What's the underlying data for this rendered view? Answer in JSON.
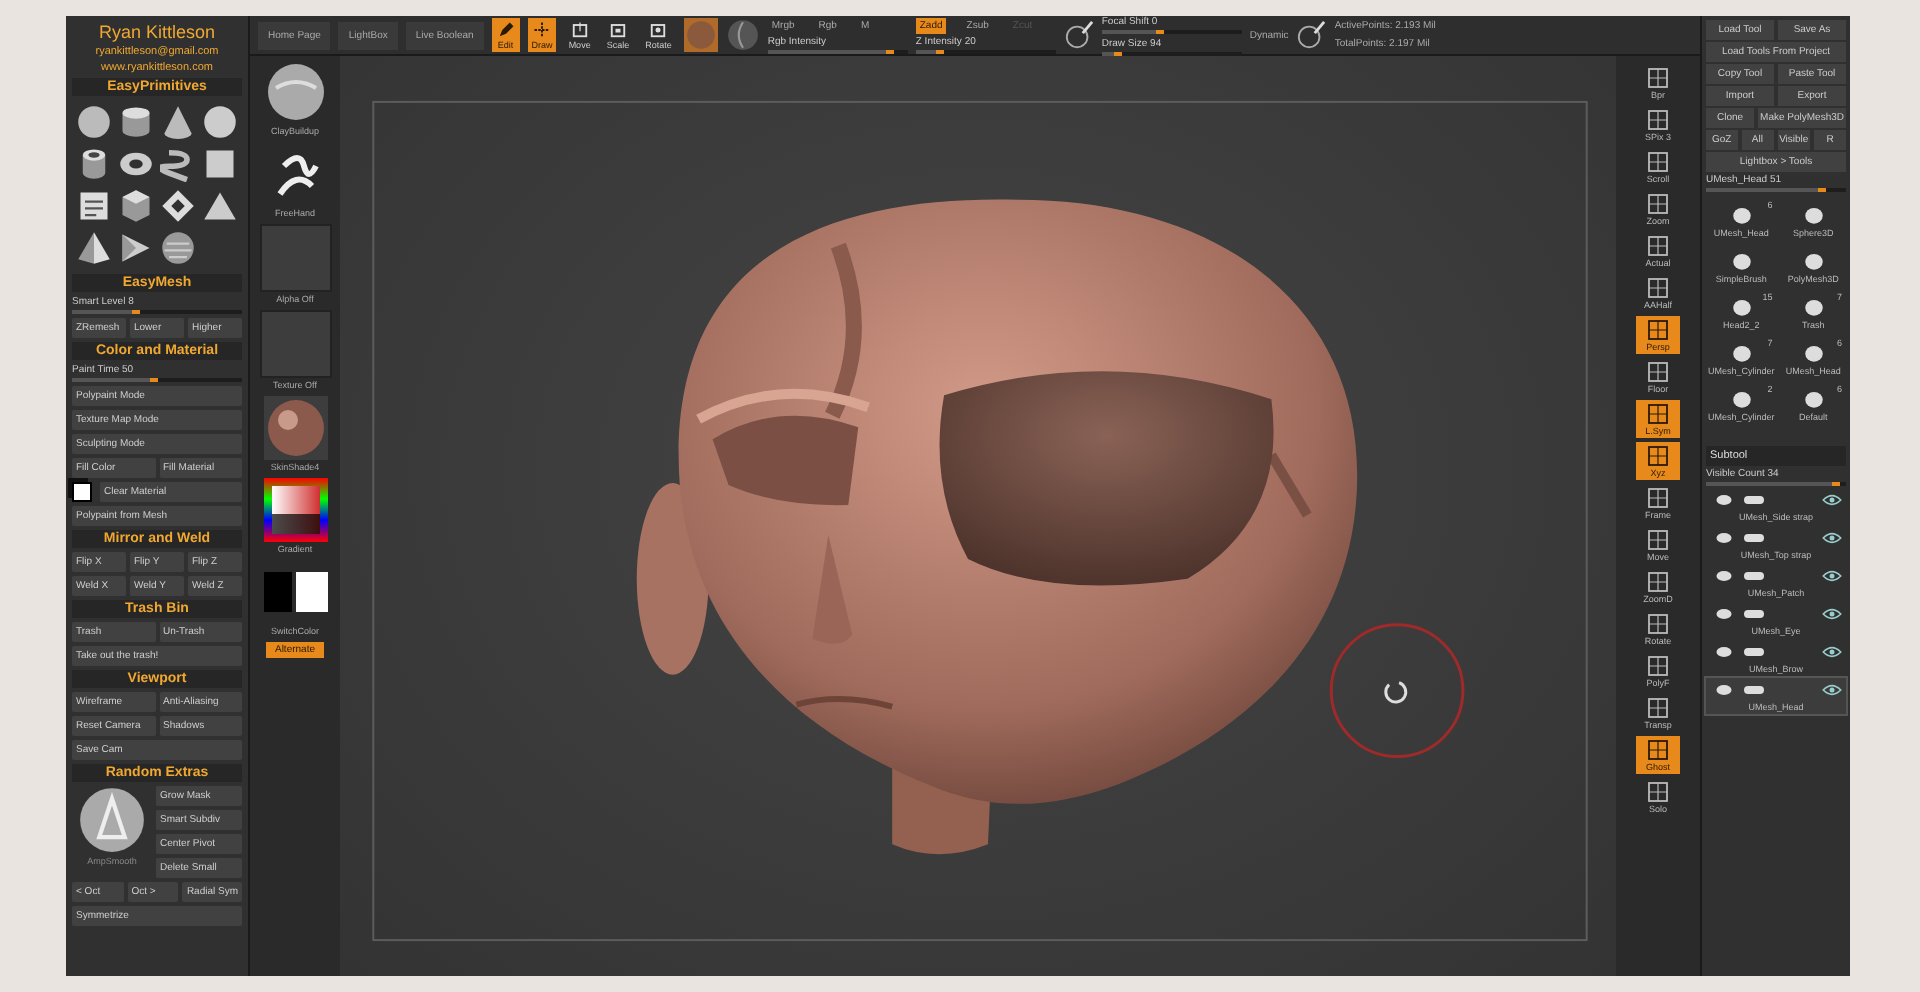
{
  "author": {
    "name": "Ryan Kittleson",
    "email": "ryankittleson@gmail.com",
    "website": "www.ryankittleson.com"
  },
  "left_sections": [
    {
      "title": "EasyPrimitives",
      "rows": [
        {
          "kind": "primitives"
        }
      ]
    },
    {
      "title": "EasyMesh",
      "rows": [
        {
          "kind": "slider",
          "label": "Smart Level 8",
          "level": 0.4
        },
        {
          "kind": "buttons",
          "buttons": [
            "ZRemesh",
            "Lower",
            "Higher"
          ]
        }
      ]
    },
    {
      "title": "Color and Material",
      "rows": [
        {
          "kind": "slider",
          "label": "Paint Time 50",
          "level": 0.5
        },
        {
          "kind": "buttons",
          "buttons": [
            "Polypaint Mode"
          ]
        },
        {
          "kind": "buttons",
          "buttons": [
            "Texture Map Mode"
          ]
        },
        {
          "kind": "buttons",
          "buttons": [
            "Sculpting Mode"
          ]
        },
        {
          "kind": "buttons",
          "buttons": [
            "Fill Color",
            "Fill Material"
          ]
        },
        {
          "kind": "swatch",
          "buttons": [
            "Clear Material"
          ]
        },
        {
          "kind": "buttons",
          "buttons": [
            "Polypaint from Mesh"
          ]
        }
      ]
    },
    {
      "title": "Mirror and Weld",
      "rows": [
        {
          "kind": "buttons",
          "buttons": [
            "Flip X",
            "Flip Y",
            "Flip Z"
          ]
        },
        {
          "kind": "buttons",
          "buttons": [
            "Weld X",
            "Weld Y",
            "Weld Z"
          ]
        }
      ]
    },
    {
      "title": "Trash Bin",
      "rows": [
        {
          "kind": "buttons",
          "buttons": [
            "Trash",
            "Un-Trash"
          ]
        },
        {
          "kind": "buttons",
          "buttons": [
            "Take out the trash!"
          ]
        }
      ]
    },
    {
      "title": "Viewport",
      "rows": [
        {
          "kind": "buttons",
          "buttons": [
            "Wireframe",
            "Anti-Aliasing"
          ]
        },
        {
          "kind": "buttons",
          "buttons": [
            "Reset Camera",
            "Shadows"
          ]
        },
        {
          "kind": "buttons",
          "buttons": [
            "Save Cam"
          ]
        }
      ]
    },
    {
      "title": "Random Extras",
      "rows": [
        {
          "kind": "extras",
          "caption": "AmpSmooth",
          "buttons": [
            "Grow Mask",
            "Smart Subdiv",
            "Center Pivot",
            "Delete Small"
          ]
        },
        {
          "kind": "buttons",
          "buttons": [
            "< Oct",
            "Oct >",
            "Radial Sym"
          ]
        },
        {
          "kind": "buttons",
          "buttons": [
            "Symmetrize"
          ]
        }
      ]
    }
  ],
  "toolbar": {
    "left_buttons": [
      "Home Page",
      "LightBox",
      "Live Boolean"
    ],
    "modes": [
      {
        "label": "Edit",
        "kind": "edit",
        "selected": true
      },
      {
        "label": "Draw",
        "kind": "draw",
        "selected": true
      },
      {
        "label": "Move",
        "kind": "move",
        "selected": false
      },
      {
        "label": "Scale",
        "kind": "scale",
        "selected": false
      },
      {
        "label": "Rotate",
        "kind": "rotate",
        "selected": false
      }
    ],
    "color_modes": [
      {
        "label": "Mrgb",
        "selected": false
      },
      {
        "label": "Rgb",
        "selected": false
      },
      {
        "label": "M",
        "selected": false
      }
    ],
    "rgb_intensity": {
      "label": "Rgb Intensity",
      "level": 0.9
    },
    "z_modes": [
      {
        "label": "Zadd",
        "selected": true,
        "disabled": false
      },
      {
        "label": "Zsub",
        "selected": false,
        "disabled": false
      },
      {
        "label": "Zcut",
        "selected": false,
        "disabled": true
      }
    ],
    "z_intensity": {
      "label": "Z Intensity 20",
      "level": 0.2
    },
    "focal_shift": {
      "label": "Focal Shift 0",
      "level": 0.45
    },
    "draw_size": {
      "label": "Draw Size 94",
      "level": 0.15
    },
    "dynamic": "Dynamic",
    "stats": [
      "ActivePoints: 2.193 Mil",
      "TotalPoints: 2.197 Mil"
    ]
  },
  "tool_slots": [
    {
      "kind": "brush",
      "label": "ClayBuildup"
    },
    {
      "kind": "stroke",
      "label": "FreeHand"
    },
    {
      "kind": "empty",
      "label": "Alpha Off"
    },
    {
      "kind": "empty",
      "label": "Texture Off"
    },
    {
      "kind": "material",
      "label": "SkinShade4"
    },
    {
      "kind": "picker",
      "label": "Gradient"
    },
    {
      "kind": "swatches",
      "label": "SwitchColor"
    },
    {
      "kind": "button",
      "label": "Alternate",
      "selected": true
    }
  ],
  "view_tools": [
    {
      "label": "Bpr",
      "selected": false
    },
    {
      "label": "SPix 3",
      "selected": false
    },
    {
      "label": "Scroll",
      "selected": false
    },
    {
      "label": "Zoom",
      "selected": false
    },
    {
      "label": "Actual",
      "selected": false
    },
    {
      "label": "AAHalf",
      "selected": false
    },
    {
      "label": "Persp",
      "selected": true
    },
    {
      "label": "Floor",
      "selected": false
    },
    {
      "label": "L.Sym",
      "selected": true
    },
    {
      "label": "Xyz",
      "selected": true
    },
    {
      "label": "Frame",
      "selected": false
    },
    {
      "label": "Move",
      "selected": false
    },
    {
      "label": "ZoomD",
      "selected": false
    },
    {
      "label": "Rotate",
      "selected": false
    },
    {
      "label": "PolyF",
      "selected": false
    },
    {
      "label": "Transp",
      "selected": false
    },
    {
      "label": "Ghost",
      "selected": true
    },
    {
      "label": "Solo",
      "selected": false
    }
  ],
  "tool_panel": {
    "button_rows": [
      [
        "Load Tool",
        "Save As"
      ],
      [
        "Load Tools From Project"
      ],
      [
        "Copy Tool",
        "Paste Tool"
      ],
      [
        "Import",
        "Export"
      ],
      [
        "Clone",
        "Make PolyMesh3D"
      ],
      [
        "GoZ",
        "All",
        "Visible",
        "R"
      ],
      [
        "Lightbox > Tools"
      ]
    ],
    "current_tool": {
      "label": "UMesh_Head 51",
      "level": 0.85
    },
    "tools": [
      {
        "label": "UMesh_Head",
        "count": "6"
      },
      {
        "label": "Sphere3D"
      },
      {
        "label": "SimpleBrush"
      },
      {
        "label": "PolyMesh3D"
      },
      {
        "label": "Head2_2",
        "count": "15"
      },
      {
        "label": "Trash",
        "count": "7"
      },
      {
        "label": "UMesh_Cylinder",
        "count": "7"
      },
      {
        "label": "UMesh_Head",
        "count": "6"
      },
      {
        "label": "UMesh_Cylinder",
        "count": "2"
      },
      {
        "label": "Default",
        "count": "6"
      }
    ]
  },
  "subtool": {
    "title": "Subtool",
    "visible_count": {
      "label": "Visible Count 34",
      "level": 0.95
    },
    "items": [
      {
        "name": "UMesh_Side strap",
        "selected": false
      },
      {
        "name": "UMesh_Top strap",
        "selected": false
      },
      {
        "name": "UMesh_Patch",
        "selected": false
      },
      {
        "name": "UMesh_Eye",
        "selected": false
      },
      {
        "name": "UMesh_Brow",
        "selected": false
      },
      {
        "name": "UMesh_Head",
        "selected": true
      }
    ]
  }
}
